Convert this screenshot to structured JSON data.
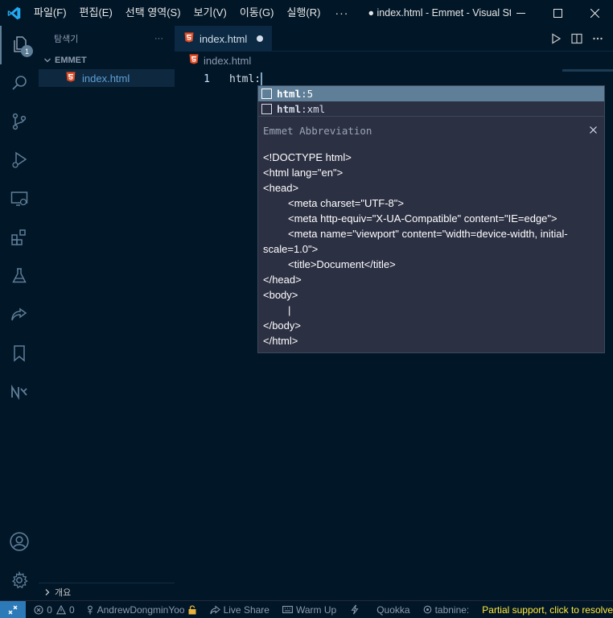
{
  "titlebar": {
    "menu": [
      "파일(F)",
      "편집(E)",
      "선택 영역(S)",
      "보기(V)",
      "이동(G)",
      "실행(R)"
    ],
    "more": "···",
    "window_title": "● index.html - Emmet - Visual Studio Code"
  },
  "activity": {
    "explorer_badge": "1"
  },
  "sidebar": {
    "title": "탐색기",
    "more": "···",
    "section": "EMMET",
    "file": "index.html",
    "footer": "개요"
  },
  "editor": {
    "tab_label": "index.html",
    "breadcrumb": "index.html",
    "line_number": "1",
    "code": "html:"
  },
  "suggest": {
    "items": [
      {
        "bold": "html",
        "rest": ":5"
      },
      {
        "bold": "html",
        "rest": ":xml"
      }
    ],
    "detail_title": "Emmet Abbreviation",
    "preview": [
      "<!DOCTYPE html>",
      "<html lang=\"en\">",
      "<head>",
      "<meta charset=\"UTF-8\">",
      "<meta http-equiv=\"X-UA-Compatible\" content=\"IE=edge\">",
      "<meta name=\"viewport\" content=\"width=device-width, initial-",
      "scale=1.0\">",
      "<title>Document</title>",
      "</head>",
      "<body>",
      "|",
      "</body>",
      "</html>"
    ]
  },
  "statusbar": {
    "errors": "0",
    "warnings": "0",
    "user": "AndrewDongminYoo",
    "live_share": "Live Share",
    "warm_up": "Warm Up",
    "quokka": "Quokka",
    "tabnine": "tabnine:",
    "partial": "Partial support, click to resolve"
  },
  "colors": {
    "background": "#011627",
    "accent": "#5f7e97",
    "html_icon": "#e44d26",
    "partial_warning": "#ffeb3b"
  }
}
